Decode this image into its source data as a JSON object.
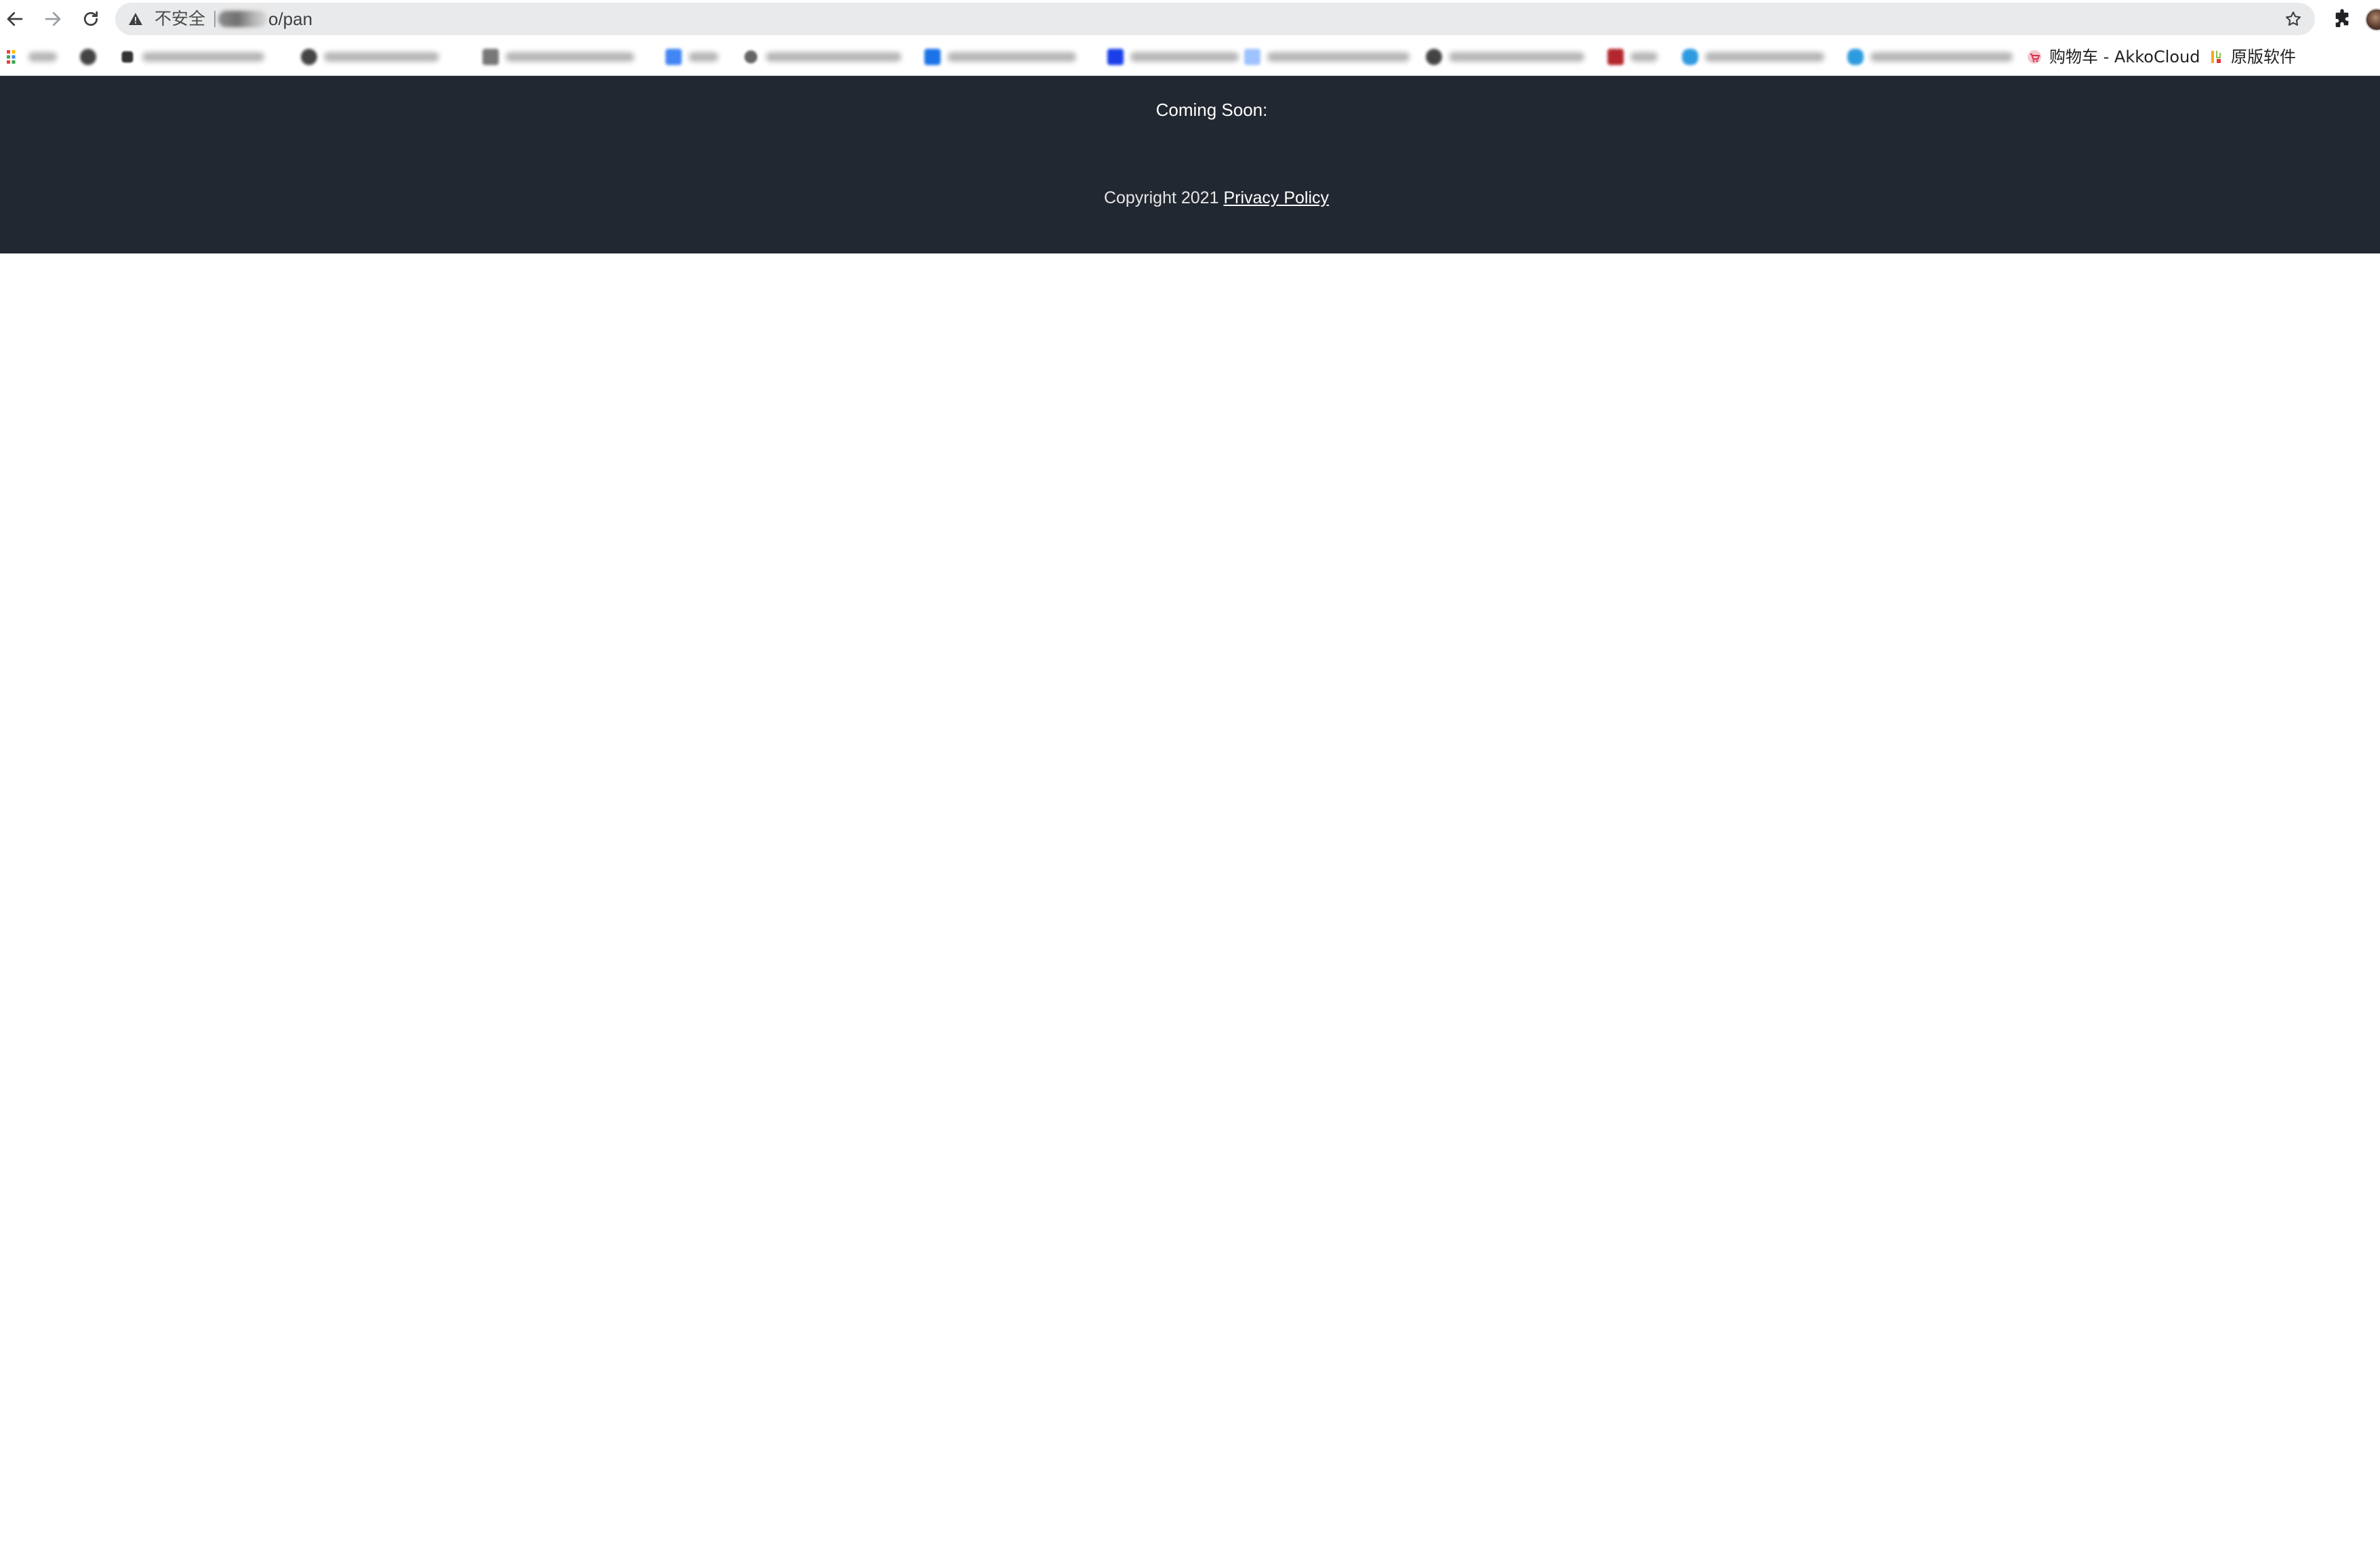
{
  "browser": {
    "security_label": "不安全",
    "url_suffix": "o/pan",
    "icons": {
      "back": "back-arrow-icon",
      "forward": "forward-arrow-icon",
      "reload": "reload-icon",
      "security": "warning-triangle-icon",
      "bookmark": "star-icon",
      "extensions": "puzzle-icon"
    }
  },
  "bookmarks": [
    {
      "label": "",
      "favicon": "apps-grid-icon",
      "blurred": true
    },
    {
      "label": "",
      "favicon": "github-icon",
      "blurred": true
    },
    {
      "label": "",
      "favicon": "chat-icon",
      "blurred": true
    },
    {
      "label": "",
      "favicon": "github-icon",
      "blurred": true
    },
    {
      "label": "",
      "favicon": "wallpaper-icon",
      "blurred": true
    },
    {
      "label": "",
      "favicon": "translate-icon",
      "blurred": true
    },
    {
      "label": "",
      "favicon": "user-icon",
      "blurred": true
    },
    {
      "label": "",
      "favicon": "drive-icon",
      "blurred": true
    },
    {
      "label": "",
      "favicon": "mail-icon",
      "blurred": true
    },
    {
      "label": "",
      "favicon": "doc-icon",
      "blurred": true
    },
    {
      "label": "",
      "favicon": "github-icon",
      "blurred": true
    },
    {
      "label": "",
      "favicon": "red-square-icon",
      "blurred": true
    },
    {
      "label": "",
      "favicon": "cloud-icon",
      "blurred": true
    },
    {
      "label": "",
      "favicon": "cloud-icon",
      "blurred": true
    },
    {
      "label": "购物车 - AkkoCloud",
      "favicon": "cart-icon",
      "blurred": false
    },
    {
      "label": "原版软件",
      "favicon": "software-icon",
      "blurred": false
    }
  ],
  "page": {
    "heading": "Coming Soon:",
    "copyright": "Copyright 2021 ",
    "privacy_link": "Privacy Policy",
    "colors": {
      "banner_background": "#222831",
      "page_background": "#ffffff",
      "text": "#ffffff"
    }
  }
}
